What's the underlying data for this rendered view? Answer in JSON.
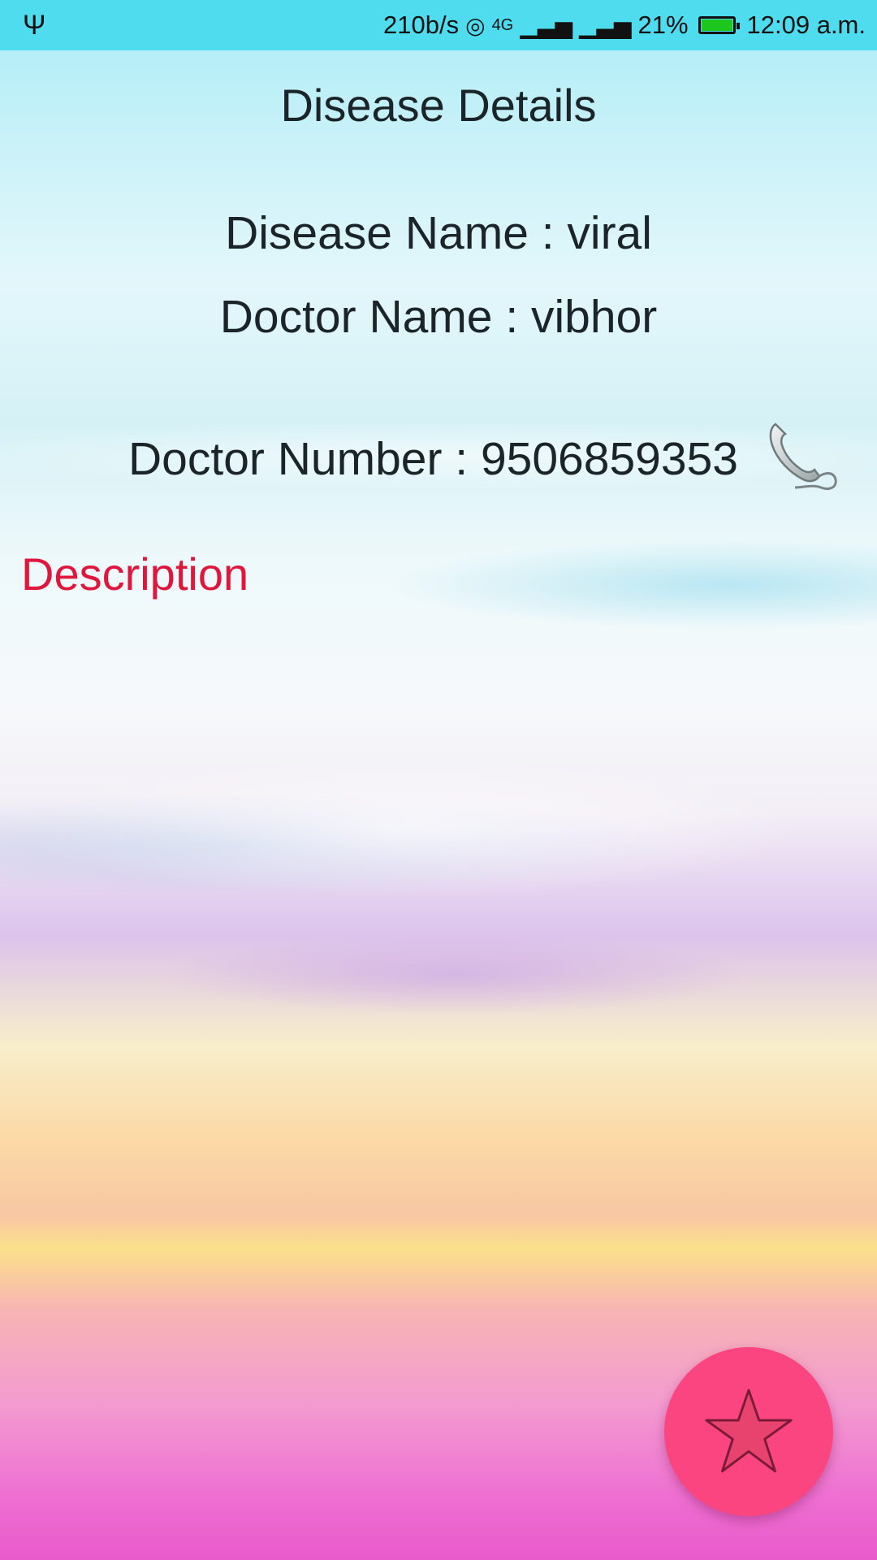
{
  "status_bar": {
    "usb_icon": "usb-icon",
    "net_speed": "210b/s",
    "hotspot_icon": "hotspot-icon",
    "network_label": "4G",
    "battery_percent": "21%",
    "battery_level": 0.96,
    "battery_color": "#1ec71e",
    "time": "12:09 a.m."
  },
  "page": {
    "title": "Disease Details",
    "disease_line": "Disease Name : viral",
    "doctor_line": "Doctor Name : vibhor",
    "number_line": "Doctor Number : 9506859353",
    "call_icon": "phone-handset-icon",
    "description_label": "Description",
    "description_color": "#e0173c"
  },
  "fab": {
    "icon": "star-icon",
    "color": "#fb4580"
  }
}
